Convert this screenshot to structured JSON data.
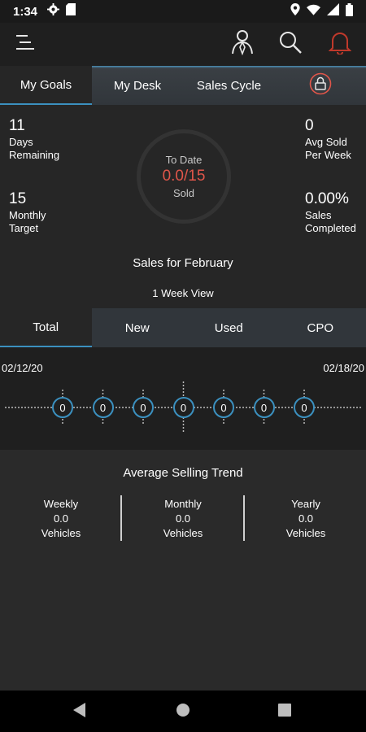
{
  "status": {
    "time": "1:34"
  },
  "tabs": {
    "my_goals": "My Goals",
    "my_desk": "My Desk",
    "sales_cycle": "Sales Cycle"
  },
  "goals": {
    "days_remaining": {
      "value": "11",
      "label1": "Days",
      "label2": "Remaining"
    },
    "monthly_target": {
      "value": "15",
      "label1": "Monthly",
      "label2": "Target"
    },
    "avg_sold": {
      "value": "0",
      "label1": "Avg Sold",
      "label2": "Per Week"
    },
    "sales_completed": {
      "value": "0.00%",
      "label1": "Sales",
      "label2": "Completed"
    },
    "ring": {
      "top_label": "To Date",
      "value": "0.0/15",
      "bottom_label": "Sold"
    },
    "sales_month": "Sales for February",
    "week_view": "1 Week View"
  },
  "type_tabs": {
    "total": "Total",
    "new": "New",
    "used": "Used",
    "cpo": "CPO"
  },
  "timeline": {
    "start_date": "02/12/20",
    "end_date": "02/18/20",
    "values": [
      "0",
      "0",
      "0",
      "0",
      "0",
      "0",
      "0"
    ]
  },
  "trend": {
    "title": "Average Selling Trend",
    "weekly": {
      "label": "Weekly",
      "value": "0.0",
      "unit": "Vehicles"
    },
    "monthly": {
      "label": "Monthly",
      "value": "0.0",
      "unit": "Vehicles"
    },
    "yearly": {
      "label": "Yearly",
      "value": "0.0",
      "unit": "Vehicles"
    }
  },
  "colors": {
    "accent": "#3b90bf",
    "alert": "#e0564a",
    "bell": "#c0392b"
  },
  "icons": [
    "gear-icon",
    "sim-card-icon",
    "location-icon",
    "wifi-icon",
    "signal-icon",
    "battery-icon",
    "menu-icon",
    "person-icon",
    "search-icon",
    "bell-icon",
    "lock-icon",
    "back-icon",
    "home-icon",
    "recents-icon"
  ]
}
